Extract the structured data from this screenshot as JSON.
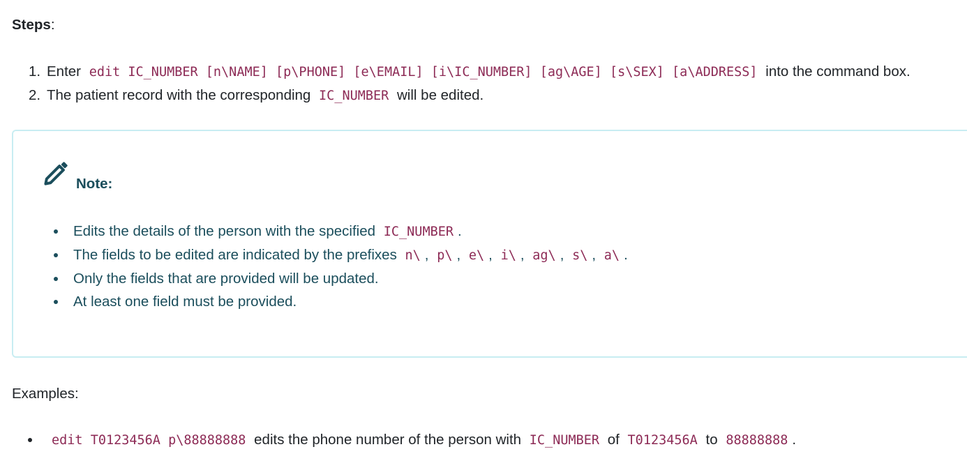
{
  "steps": {
    "heading": "Steps",
    "colon": ":",
    "items": [
      {
        "number": "1.",
        "before": "Enter",
        "code": "edit IC_NUMBER [n\\NAME] [p\\PHONE] [e\\EMAIL] [i\\IC_NUMBER] [ag\\AGE] [s\\SEX] [a\\ADDRESS]",
        "after": "into the command box."
      },
      {
        "number": "2.",
        "before": "The patient record with the corresponding",
        "code": "IC_NUMBER",
        "after": "will be edited."
      }
    ]
  },
  "note": {
    "icon": "pencil-icon",
    "title": "Note:",
    "items": [
      {
        "before": "Edits the details of the person with the specified",
        "code": "IC_NUMBER",
        "after": "."
      },
      {
        "before": "The fields to be edited are indicated by the prefixes",
        "prefixes": [
          "n\\",
          "p\\",
          "e\\",
          "i\\",
          "ag\\",
          "s\\",
          "a\\"
        ],
        "separator": ",",
        "after": "."
      },
      {
        "text": "Only the fields that are provided will be updated."
      },
      {
        "text": "At least one field must be provided."
      }
    ]
  },
  "examples": {
    "heading": "Examples:",
    "items": [
      {
        "code1": "edit T0123456A p\\88888888",
        "text1": "edits the phone number of the person with",
        "code2": "IC_NUMBER",
        "text2": "of",
        "code3": "T0123456A",
        "text3": "to",
        "code4": "88888888",
        "after": "."
      }
    ]
  },
  "colors": {
    "code": "#8d2b56",
    "note_text": "#1b4e5c",
    "note_border": "#c8edf2",
    "body_text": "#212529"
  }
}
